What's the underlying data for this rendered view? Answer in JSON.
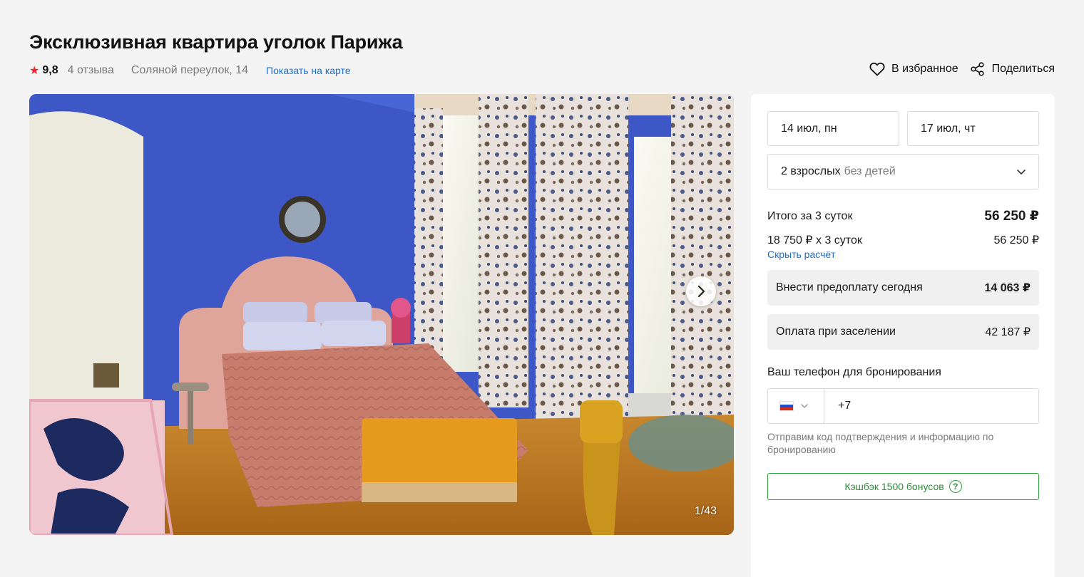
{
  "listing": {
    "title": "Эксклюзивная квартира уголок Парижа",
    "rating": "9,8",
    "reviews": "4 отзыва",
    "address": "Соляной переулок, 14",
    "map_link": "Показать на карте"
  },
  "actions": {
    "favorite": "В избранное",
    "share": "Поделиться"
  },
  "gallery": {
    "counter": "1/43",
    "icons": [
      "chevron-right-icon"
    ]
  },
  "booking": {
    "checkin": "14 июл, пн",
    "checkout": "17 июл, чт",
    "guests": "2 взрослых",
    "children": "без детей",
    "total_label": "Итого за 3 суток",
    "total_value": "56 250 ₽",
    "calc_label": "18 750 ₽ x 3 суток",
    "calc_value": "56 250 ₽",
    "hide_link": "Скрыть расчёт",
    "prepay_label": "Внести предоплату сегодня",
    "prepay_value": "14 063 ₽",
    "checkin_pay_label": "Оплата при заселении",
    "checkin_pay_value": "42 187 ₽",
    "phone_label": "Ваш телефон для бронирования",
    "phone_prefix": "+7",
    "phone_note": "Отправим код подтверждения и информацию по бронированию",
    "cashback": "Кэшбэк 1500 бонусов",
    "help": "?"
  },
  "colors": {
    "accent_link": "#1a6fd1",
    "star": "#f0232f",
    "cashback_green": "#2e9f3c"
  }
}
